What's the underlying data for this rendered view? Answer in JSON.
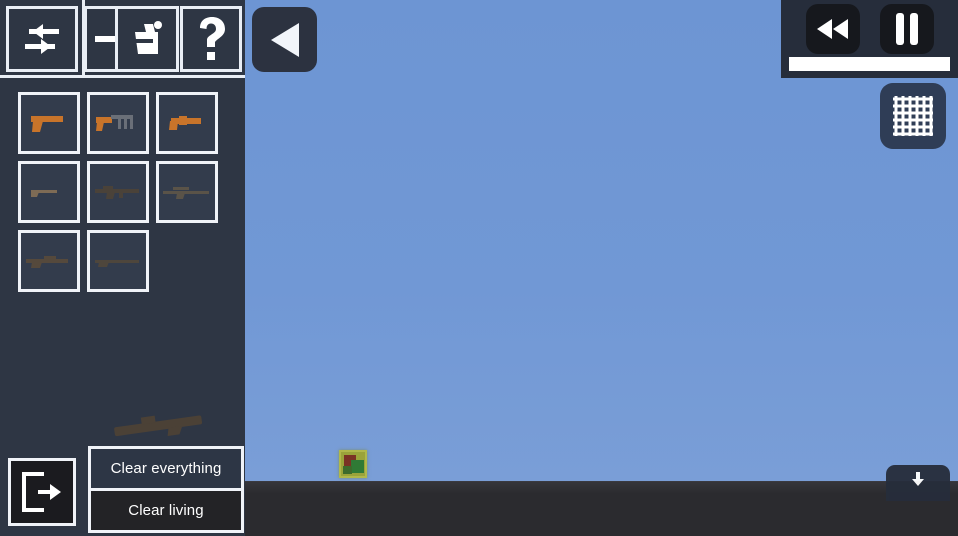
{
  "app": {
    "title": "Sandbox Physics Game",
    "colors": {
      "sky": "#6e96d4",
      "ground": "#2b2b2f",
      "sidebar": "#2e3644",
      "slot_border": "#f0f3f8",
      "accent_white": "#ffffff",
      "panel_dark": "#262d3b"
    }
  },
  "sidebar": {
    "toolbar": {
      "items": [
        {
          "name": "swap-tool",
          "icon": "swap-arrows-icon",
          "label": "Swap"
        },
        {
          "name": "enter-tool",
          "icon": "arrow-into-icon",
          "label": "Enter"
        },
        {
          "name": "paint-tool",
          "icon": "paint-bucket-icon",
          "label": "Paint"
        },
        {
          "name": "help-tool",
          "icon": "question-mark-icon",
          "label": "Help"
        }
      ]
    },
    "weapons": {
      "rows": [
        [
          {
            "name": "pistol",
            "label": "Pistol",
            "tone": "orange"
          },
          {
            "name": "smg",
            "label": "SMG",
            "tone": "orange"
          },
          {
            "name": "revolver",
            "label": "Revolver",
            "tone": "orange"
          }
        ],
        [
          {
            "name": "shotgun",
            "label": "Shotgun",
            "tone": "dark"
          },
          {
            "name": "assault-rifle",
            "label": "Assault Rifle",
            "tone": "dark"
          },
          {
            "name": "sniper-rifle",
            "label": "Sniper Rifle",
            "tone": "dark"
          }
        ],
        [
          {
            "name": "machine-gun",
            "label": "Machine Gun",
            "tone": "dark"
          },
          {
            "name": "rifle",
            "label": "Rifle",
            "tone": "dark"
          }
        ]
      ]
    },
    "floating_weapon": {
      "name": "rocket-launcher",
      "label": "Rocket Launcher"
    },
    "exit_button": {
      "icon": "exit-door-icon",
      "label": "Exit"
    },
    "clear_buttons": [
      {
        "name": "clear-everything",
        "label": "Clear everything"
      },
      {
        "name": "clear-living",
        "label": "Clear living"
      }
    ]
  },
  "scene": {
    "back_button": {
      "icon": "play-left-triangle-icon",
      "label": "Back"
    },
    "entity": {
      "name": "spawned-entity",
      "label": "Entity"
    },
    "playback": {
      "rewind_button": {
        "icon": "rewind-icon",
        "label": "Rewind"
      },
      "pause_button": {
        "icon": "pause-icon",
        "label": "Pause"
      },
      "speed_bar": {
        "label": "Speed",
        "value": 100,
        "max": 100
      }
    },
    "grid_button": {
      "icon": "grid-icon",
      "label": "Grid"
    },
    "download_button": {
      "icon": "download-icon",
      "label": "Download"
    }
  }
}
